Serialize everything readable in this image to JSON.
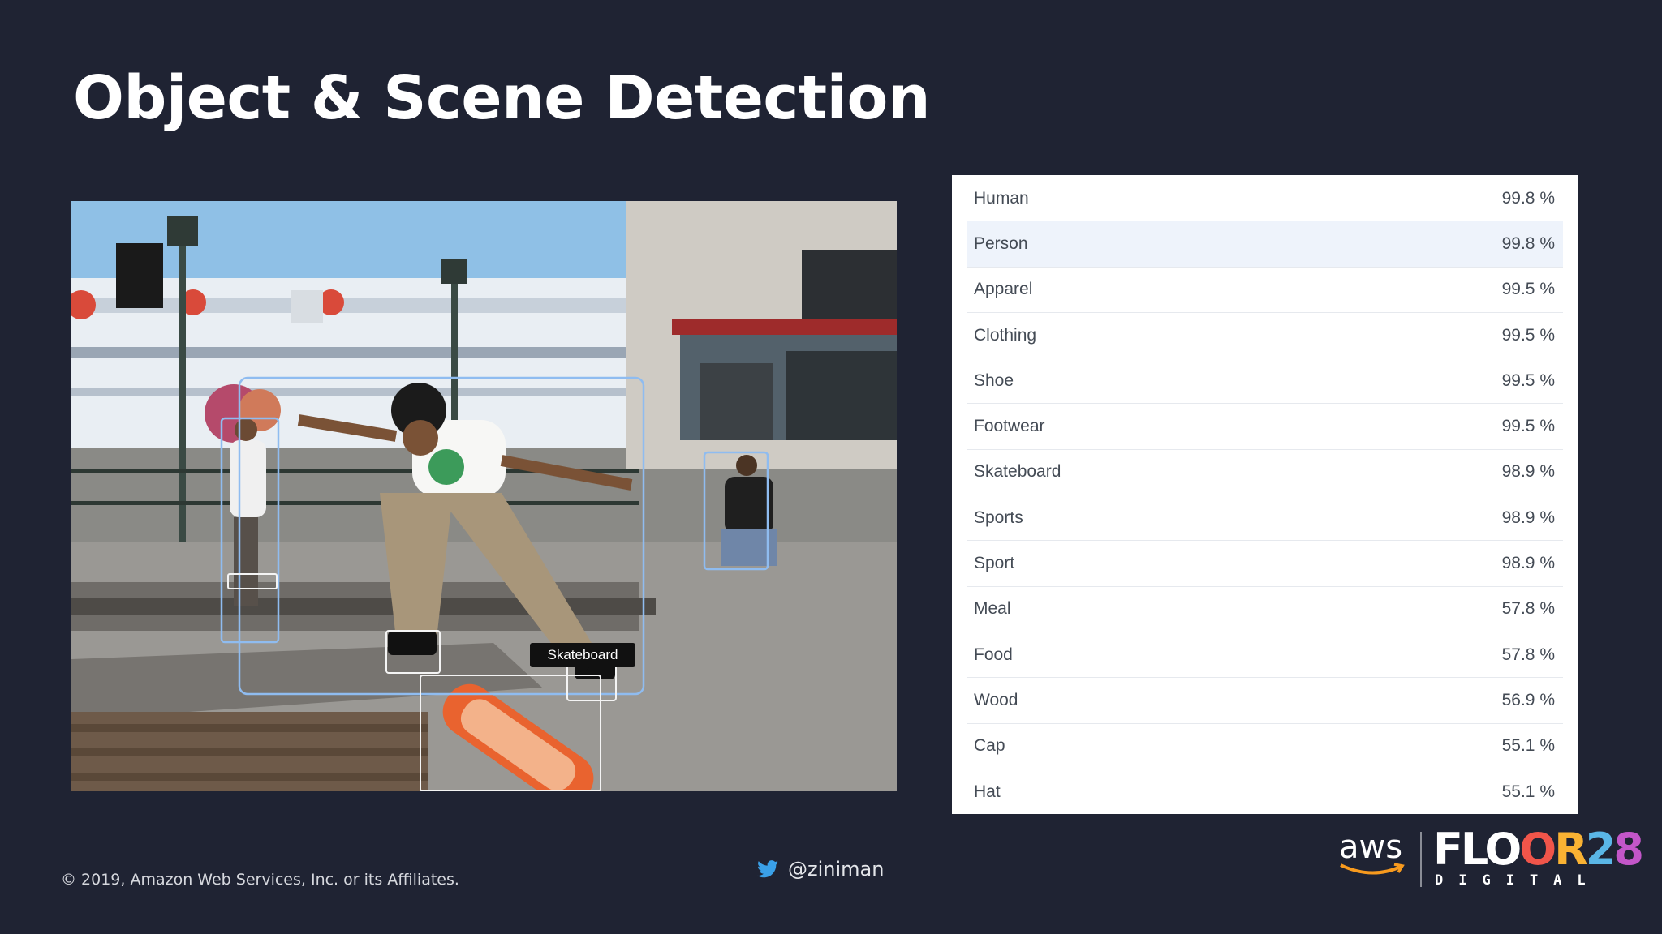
{
  "slide": {
    "title": "Object & Scene Detection"
  },
  "photo": {
    "detection_label": "Skateboard"
  },
  "labels_table": {
    "rows": [
      {
        "name": "Human",
        "confidence": "99.8 %"
      },
      {
        "name": "Person",
        "confidence": "99.8 %",
        "selected": true
      },
      {
        "name": "Apparel",
        "confidence": "99.5 %"
      },
      {
        "name": "Clothing",
        "confidence": "99.5 %"
      },
      {
        "name": "Shoe",
        "confidence": "99.5 %"
      },
      {
        "name": "Footwear",
        "confidence": "99.5 %"
      },
      {
        "name": "Skateboard",
        "confidence": "98.9 %"
      },
      {
        "name": "Sports",
        "confidence": "98.9 %"
      },
      {
        "name": "Sport",
        "confidence": "98.9 %"
      },
      {
        "name": "Meal",
        "confidence": "57.8 %"
      },
      {
        "name": "Food",
        "confidence": "57.8 %"
      },
      {
        "name": "Wood",
        "confidence": "56.9 %"
      },
      {
        "name": "Cap",
        "confidence": "55.1 %"
      },
      {
        "name": "Hat",
        "confidence": "55.1 %"
      }
    ]
  },
  "footer": {
    "copyright": "© 2019, Amazon Web Services, Inc. or its Affiliates.",
    "twitter_handle": "@ziniman",
    "twitter_icon": "twitter-bird-icon",
    "aws_logo_text": "aws",
    "event_logo_main": "FLOOR28",
    "event_logo_sub": "DIGITAL"
  },
  "colors": {
    "background": "#1f2333",
    "bounding_box": "#8fbcf0",
    "aws_smile": "#f79a1e",
    "selected_row": "#eef3fb"
  }
}
